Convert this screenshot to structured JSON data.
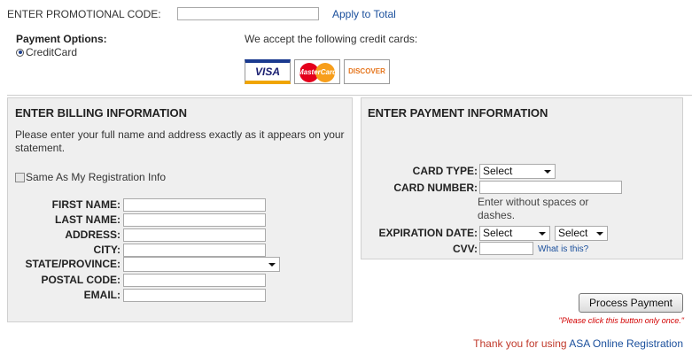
{
  "promo": {
    "label": "ENTER PROMOTIONAL CODE:",
    "value": "",
    "apply_label": "Apply to Total"
  },
  "payment_options": {
    "title": "Payment Options:",
    "selected": "CreditCard",
    "accept_text": "We accept the following credit cards:",
    "cards": [
      "VISA",
      "MasterCard",
      "DISCOVER"
    ]
  },
  "billing": {
    "title": "ENTER BILLING INFORMATION",
    "instructions": "Please enter your full name and address exactly as it appears on your statement.",
    "same_as_label": "Same As My Registration Info",
    "fields": {
      "first_name": "FIRST NAME:",
      "last_name": "LAST NAME:",
      "address": "ADDRESS:",
      "city": "CITY:",
      "state": "STATE/PROVINCE:",
      "postal": "POSTAL CODE:",
      "email": "EMAIL:"
    }
  },
  "payment": {
    "title": "ENTER PAYMENT INFORMATION",
    "card_type_label": "CARD TYPE:",
    "card_type_value": "Select",
    "card_number_label": "CARD NUMBER:",
    "card_number_hint": "Enter without spaces or dashes.",
    "expiration_label": "EXPIRATION DATE:",
    "exp_month_value": "Select",
    "exp_year_value": "Select",
    "cvv_label": "CVV:",
    "cvv_link": "What is this?"
  },
  "actions": {
    "process_label": "Process Payment",
    "warning": "\"Please click this button only once.\""
  },
  "footer": {
    "thanks_prefix": "Thank you for using ",
    "thanks_link": "ASA Online Registration"
  },
  "colors": {
    "link": "#1a4f9c",
    "warning": "#d20000",
    "panel_bg": "#efefef"
  }
}
